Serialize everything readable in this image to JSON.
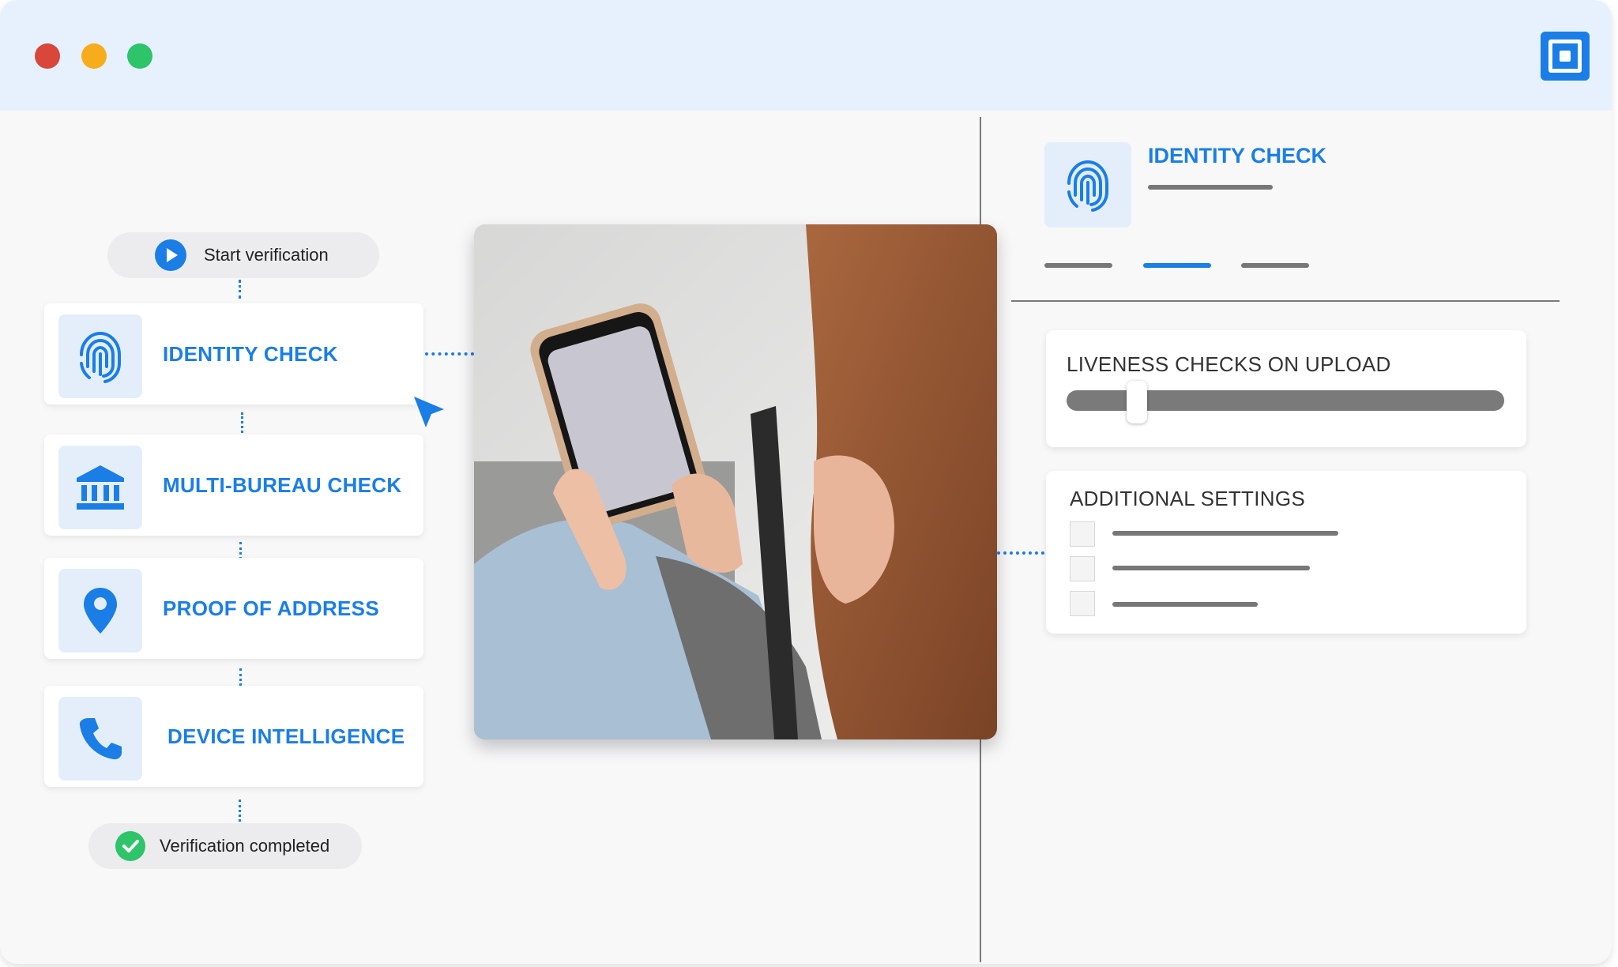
{
  "colors": {
    "accent": "#1a7ee6",
    "titlebar": "#e6f1fd",
    "success": "#2dc46a",
    "close_light": "#d9473a",
    "minimize_light": "#f7ac1c",
    "zoom_light": "#2dc46a"
  },
  "window": {
    "controls": [
      "close-light",
      "minimize-light",
      "zoom-light"
    ],
    "app_icon": "square-target-icon"
  },
  "flow": {
    "start_label": "Start verification",
    "start_icon": "play-icon",
    "steps": [
      {
        "label": "IDENTITY CHECK",
        "icon": "fingerprint-icon"
      },
      {
        "label": "MULTI-BUREAU CHECK",
        "icon": "bank-icon"
      },
      {
        "label": "PROOF OF ADDRESS",
        "icon": "map-pin-icon"
      },
      {
        "label": "DEVICE INTELLIGENCE",
        "icon": "phone-icon"
      }
    ],
    "end_label": "Verification completed",
    "end_icon": "check-circle-icon"
  },
  "panel": {
    "title": "IDENTITY CHECK",
    "icon": "fingerprint-icon",
    "tabs_count": 3,
    "active_tab": 1,
    "liveness": {
      "title": "LIVENESS CHECKS ON UPLOAD",
      "level": 0.16
    },
    "settings": {
      "title": "ADDITIONAL SETTINGS",
      "checkbox_count": 3
    }
  }
}
